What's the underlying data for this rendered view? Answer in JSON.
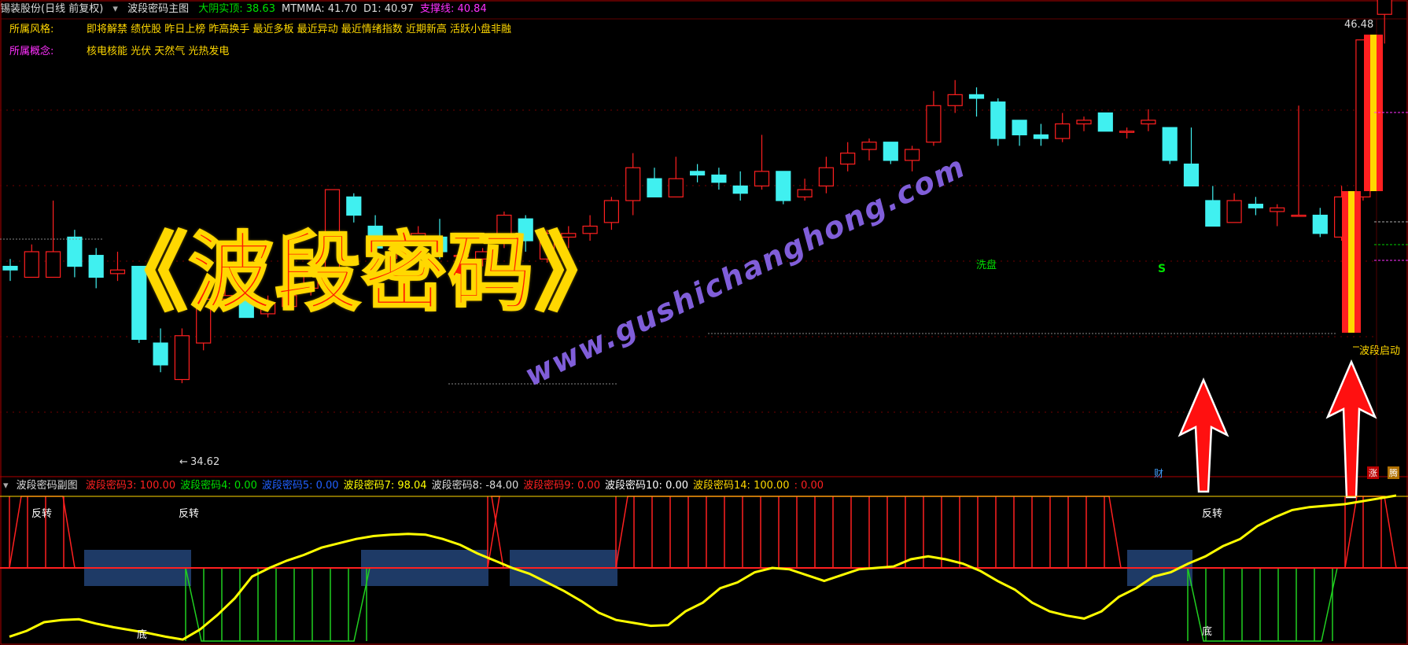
{
  "header": {
    "stock_name": "锡装股份(日线 前复权)",
    "indicator_name": "波段密码主图",
    "items": [
      {
        "label": "大阴实顶:",
        "value": "38.63",
        "color": "#00e000"
      },
      {
        "label": "MTMMA:",
        "value": "41.70",
        "color": "#dddddd"
      },
      {
        "label": "D1:",
        "value": "40.97",
        "color": "#dddddd"
      },
      {
        "label": "支撑线:",
        "value": "40.84",
        "color": "#ff30ff"
      }
    ]
  },
  "info": {
    "style_label": "所属风格:",
    "style_value": "即将解禁 绩优股 昨日上榜 昨高换手 最近多板 最近异动 最近情绪指数 近期新高 活跃小盘非融",
    "concept_label": "所属概念:",
    "concept_value": "核电核能 光伏 天然气 光热发电"
  },
  "overlay": {
    "title": "《波段密码》",
    "watermark": "www.gushichanghong.com"
  },
  "annotations": {
    "wash": "洗盘",
    "s_mark": "S",
    "start": "波段启动",
    "low_price": "34.62",
    "high_price": "46.48",
    "cai": "财",
    "zhang": "涨",
    "reverse": "反转",
    "bottom": "底",
    "tab_zhang": "涨",
    "tab_teng": "腾"
  },
  "sub_header": {
    "name": "波段密码副图",
    "items": [
      {
        "label": "波段密码3:",
        "value": "100.00",
        "color": "#ff2020"
      },
      {
        "label": "波段密码4:",
        "value": "0.00",
        "color": "#00e000"
      },
      {
        "label": "波段密码5:",
        "value": "0.00",
        "color": "#2060ff"
      },
      {
        "label": "波段密码7:",
        "value": "98.04",
        "color": "#ffff00"
      },
      {
        "label": "波段密码8:",
        "value": "-84.00",
        "color": "#dddddd"
      },
      {
        "label": "波段密码9:",
        "value": "0.00",
        "color": "#ff2020"
      },
      {
        "label": "波段密码10:",
        "value": "0.00",
        "color": "#ffffff"
      },
      {
        "label": "波段密码14:",
        "value": "100.00",
        "color": "#ffd800"
      },
      {
        "label": ":",
        "value": "0.00",
        "color": "#ff2020"
      }
    ]
  },
  "colors": {
    "up": "#ff2020",
    "down": "#40f0f0",
    "oscillator": "#ffff00",
    "bull_bar": "#ff2020",
    "bear_bar": "#20d020",
    "zone": "#1e3a66"
  },
  "chart_data": [
    {
      "type": "candlestick",
      "title": "",
      "candles": [
        {
          "o": 41.2,
          "c": 41.1,
          "h": 41.4,
          "l": 40.8
        },
        {
          "o": 40.9,
          "c": 41.6,
          "h": 41.8,
          "l": 40.9
        },
        {
          "o": 40.9,
          "c": 41.6,
          "h": 43.0,
          "l": 40.9
        },
        {
          "o": 42.0,
          "c": 41.2,
          "h": 42.2,
          "l": 40.9
        },
        {
          "o": 41.5,
          "c": 40.9,
          "h": 41.7,
          "l": 40.6
        },
        {
          "o": 41.0,
          "c": 41.1,
          "h": 41.6,
          "l": 40.8
        },
        {
          "o": 41.2,
          "c": 39.2,
          "h": 41.2,
          "l": 39.1
        },
        {
          "o": 39.1,
          "c": 38.5,
          "h": 39.5,
          "l": 38.3
        },
        {
          "o": 38.1,
          "c": 39.3,
          "h": 39.5,
          "l": 38.0
        },
        {
          "o": 39.1,
          "c": 40.3,
          "h": 40.3,
          "l": 38.9
        },
        {
          "o": 40.3,
          "c": 40.4,
          "h": 40.6,
          "l": 40.0
        },
        {
          "o": 40.3,
          "c": 39.8,
          "h": 40.3,
          "l": 39.8
        },
        {
          "o": 39.9,
          "c": 40.2,
          "h": 40.4,
          "l": 39.8
        },
        {
          "o": 40.1,
          "c": 40.4,
          "h": 40.6,
          "l": 40.0
        },
        {
          "o": 40.6,
          "c": 41.1,
          "h": 41.5,
          "l": 40.4
        },
        {
          "o": 41.1,
          "c": 43.3,
          "h": 43.3,
          "l": 41.0
        },
        {
          "o": 43.1,
          "c": 42.6,
          "h": 43.2,
          "l": 42.4
        },
        {
          "o": 42.3,
          "c": 41.7,
          "h": 42.6,
          "l": 41.1
        },
        {
          "o": 41.6,
          "c": 41.9,
          "h": 42.0,
          "l": 41.4
        },
        {
          "o": 41.9,
          "c": 42.1,
          "h": 42.3,
          "l": 41.8
        },
        {
          "o": 42.0,
          "c": 41.6,
          "h": 42.5,
          "l": 41.4
        },
        {
          "o": 41.5,
          "c": 41.5,
          "h": 41.8,
          "l": 41.1
        },
        {
          "o": 41.4,
          "c": 41.6,
          "h": 41.7,
          "l": 41.2
        },
        {
          "o": 41.9,
          "c": 42.6,
          "h": 42.7,
          "l": 41.7
        },
        {
          "o": 42.5,
          "c": 41.9,
          "h": 42.6,
          "l": 41.6
        },
        {
          "o": 41.4,
          "c": 42.1,
          "h": 42.2,
          "l": 41.3
        },
        {
          "o": 42.0,
          "c": 42.1,
          "h": 42.3,
          "l": 41.7
        },
        {
          "o": 42.1,
          "c": 42.3,
          "h": 42.6,
          "l": 41.9
        },
        {
          "o": 42.4,
          "c": 43.0,
          "h": 43.1,
          "l": 42.2
        },
        {
          "o": 43.0,
          "c": 43.9,
          "h": 44.3,
          "l": 42.6
        },
        {
          "o": 43.6,
          "c": 43.1,
          "h": 43.9,
          "l": 43.1
        },
        {
          "o": 43.1,
          "c": 43.6,
          "h": 44.2,
          "l": 43.1
        },
        {
          "o": 43.8,
          "c": 43.7,
          "h": 44.0,
          "l": 43.5
        },
        {
          "o": 43.7,
          "c": 43.5,
          "h": 43.9,
          "l": 43.3
        },
        {
          "o": 43.4,
          "c": 43.2,
          "h": 43.8,
          "l": 43.0
        },
        {
          "o": 43.4,
          "c": 43.8,
          "h": 44.8,
          "l": 43.3
        },
        {
          "o": 43.8,
          "c": 43.0,
          "h": 43.8,
          "l": 42.9
        },
        {
          "o": 43.1,
          "c": 43.3,
          "h": 43.6,
          "l": 43.0
        },
        {
          "o": 43.4,
          "c": 43.9,
          "h": 44.2,
          "l": 43.2
        },
        {
          "o": 44.0,
          "c": 44.3,
          "h": 44.6,
          "l": 43.8
        },
        {
          "o": 44.4,
          "c": 44.6,
          "h": 44.7,
          "l": 44.1
        },
        {
          "o": 44.6,
          "c": 44.1,
          "h": 44.6,
          "l": 44.0
        },
        {
          "o": 44.1,
          "c": 44.4,
          "h": 44.5,
          "l": 43.8
        },
        {
          "o": 44.6,
          "c": 45.6,
          "h": 46.0,
          "l": 44.5
        },
        {
          "o": 45.6,
          "c": 45.9,
          "h": 46.3,
          "l": 45.4
        },
        {
          "o": 45.9,
          "c": 45.8,
          "h": 46.1,
          "l": 45.3
        },
        {
          "o": 45.7,
          "c": 44.7,
          "h": 45.8,
          "l": 44.5
        },
        {
          "o": 45.2,
          "c": 44.8,
          "h": 45.2,
          "l": 44.5
        },
        {
          "o": 44.8,
          "c": 44.7,
          "h": 45.1,
          "l": 44.5
        },
        {
          "o": 44.7,
          "c": 45.1,
          "h": 45.4,
          "l": 44.6
        },
        {
          "o": 45.1,
          "c": 45.2,
          "h": 45.3,
          "l": 44.9
        },
        {
          "o": 45.4,
          "c": 44.9,
          "h": 45.4,
          "l": 44.9
        },
        {
          "o": 44.9,
          "c": 44.9,
          "h": 45.0,
          "l": 44.7
        },
        {
          "o": 45.1,
          "c": 45.2,
          "h": 45.5,
          "l": 44.9
        },
        {
          "o": 45.0,
          "c": 44.1,
          "h": 45.0,
          "l": 44.0
        },
        {
          "o": 44.0,
          "c": 43.4,
          "h": 45.0,
          "l": 43.4
        },
        {
          "o": 43.0,
          "c": 42.3,
          "h": 43.4,
          "l": 42.3
        },
        {
          "o": 42.4,
          "c": 43.0,
          "h": 43.2,
          "l": 42.4
        },
        {
          "o": 42.9,
          "c": 42.8,
          "h": 43.1,
          "l": 42.6
        },
        {
          "o": 42.7,
          "c": 42.8,
          "h": 42.9,
          "l": 42.3
        },
        {
          "o": 42.6,
          "c": 42.6,
          "h": 45.6,
          "l": 42.6
        },
        {
          "o": 42.6,
          "c": 42.1,
          "h": 42.8,
          "l": 42.0
        },
        {
          "o": 42.0,
          "c": 43.1,
          "h": 43.4,
          "l": 41.9
        },
        {
          "o": 43.1,
          "c": 47.4,
          "h": 47.4,
          "l": 43.0
        },
        {
          "o": 48.1,
          "c": 52.2,
          "h": 52.4,
          "l": 47.3
        },
        {
          "o": 52.0,
          "c": 51.0,
          "h": 52.4,
          "l": 49.6
        }
      ],
      "price_labels": {
        "low": "34.62",
        "high": "46.48"
      }
    },
    {
      "type": "line",
      "title": "",
      "ylim": [
        -100,
        100
      ],
      "series": [
        {
          "values": [
            -95,
            -87,
            -75,
            -72,
            -71,
            -77,
            -82,
            -86,
            -90,
            -95,
            -99,
            -85,
            -65,
            -42,
            -12,
            0,
            10,
            18,
            28,
            34,
            40,
            44,
            46,
            47,
            46,
            40,
            32,
            20,
            10,
            0,
            -8,
            -20,
            -32,
            -46,
            -62,
            -72,
            -76,
            -80,
            -79,
            -60,
            -48,
            -28,
            -20,
            -6,
            0,
            -2,
            -10,
            -18,
            -10,
            -2,
            0,
            2,
            12,
            16,
            12,
            6,
            -4,
            -18,
            -30,
            -48,
            -60,
            -66,
            -70,
            -60,
            -40,
            -28,
            -12,
            -6,
            6,
            16,
            30,
            40,
            58,
            70,
            80,
            84,
            86,
            88,
            92,
            96,
            100
          ]
        }
      ]
    }
  ]
}
